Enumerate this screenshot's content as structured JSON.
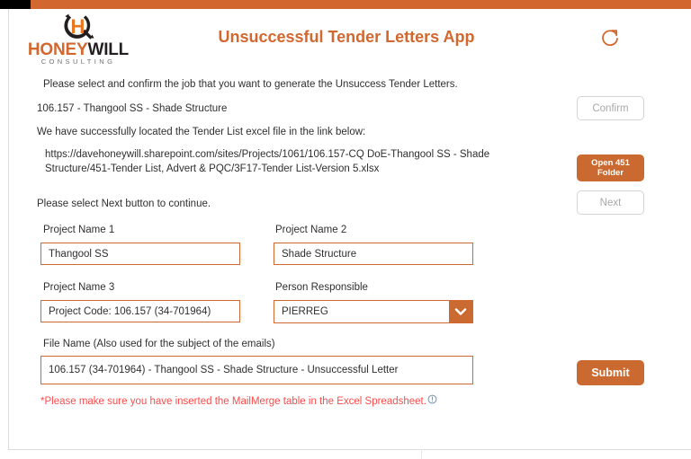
{
  "window": {
    "accent_color": "#d2682f",
    "button_color": "#ca6a30",
    "warning_color": "#fa4b4b"
  },
  "header": {
    "title": "Unsuccessful Tender Letters App",
    "refresh_icon": "refresh-circular-arrow-icon",
    "logo": {
      "mark_icon": "honeywill-circular-h-logo-icon",
      "word_primary": "HONEY",
      "word_secondary": "WILL",
      "subtitle": "CONSULTING"
    }
  },
  "body": {
    "intro": "Please select and confirm the job that you want to generate the Unsuccess Tender Letters.",
    "job": "106.157 - Thangool SS - Shade Structure",
    "located": "We have successfully located the Tender List excel file in the link below:",
    "url": "https://davehoneywill.sharepoint.com/sites/Projects/1061/106.157-CQ DoE-Thangool SS - Shade Structure/451-Tender List, Advert & PQC/3F17-Tender List-Version 5.xlsx",
    "next_hint": "Please select Next button to continue."
  },
  "actions": {
    "confirm": "Confirm",
    "open_folder_line1": "Open 451",
    "open_folder_line2": "Folder",
    "next": "Next",
    "submit": "Submit"
  },
  "form": {
    "project_name_1": {
      "label": "Project Name 1",
      "value": "Thangool SS",
      "placeholder": "Project Name 1"
    },
    "project_name_2": {
      "label": "Project Name 2",
      "value": "Shade Structure",
      "placeholder": "Project Name 2"
    },
    "project_name_3": {
      "label": "Project Name 3",
      "value": "Project Code: 106.157 (34-701964)",
      "placeholder": "Project Name 3"
    },
    "person_responsible": {
      "label": "Person Responsible",
      "value": "PIERREG",
      "dropdown_icon": "chevron-down-icon"
    },
    "file_name": {
      "label": "File Name (Also used for the subject of the emails)",
      "value": "106.157 (34-701964) - Thangool SS - Shade Structure - Unsuccessful Letter",
      "placeholder": "File Name"
    }
  },
  "warning": {
    "text": "*Please make sure you have inserted the MailMerge table in the Excel Spreadsheet.",
    "icon": "info-circle-icon"
  }
}
